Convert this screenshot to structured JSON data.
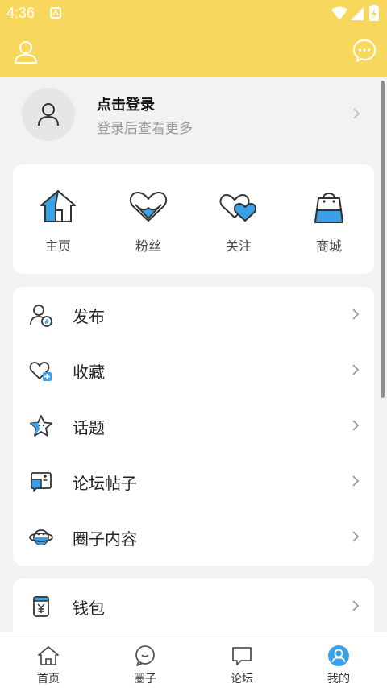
{
  "status": {
    "time": "4:36"
  },
  "profile": {
    "title": "点击登录",
    "subtitle": "登录后查看更多"
  },
  "quick_actions": [
    {
      "label": "主页",
      "icon": "home-icon"
    },
    {
      "label": "粉丝",
      "icon": "heart-fans-icon"
    },
    {
      "label": "关注",
      "icon": "double-heart-icon"
    },
    {
      "label": "商城",
      "icon": "shopping-bag-icon"
    }
  ],
  "menu": [
    {
      "label": "发布",
      "icon": "user-star-icon"
    },
    {
      "label": "收藏",
      "icon": "heart-plus-icon"
    },
    {
      "label": "话题",
      "icon": "star-icon"
    },
    {
      "label": "论坛帖子",
      "icon": "forum-post-icon"
    },
    {
      "label": "圈子内容",
      "icon": "planet-icon"
    }
  ],
  "wallet": {
    "label": "钱包",
    "icon": "wallet-icon"
  },
  "bottom_nav": [
    {
      "label": "首页",
      "icon": "home-outline-icon"
    },
    {
      "label": "圈子",
      "icon": "chat-bubble-icon"
    },
    {
      "label": "论坛",
      "icon": "message-square-icon"
    },
    {
      "label": "我的",
      "icon": "profile-filled-icon",
      "active": true
    }
  ],
  "colors": {
    "header_bg": "#f7d85c",
    "accent_blue": "#3aa0e8",
    "page_bg": "#f2f2f2"
  }
}
